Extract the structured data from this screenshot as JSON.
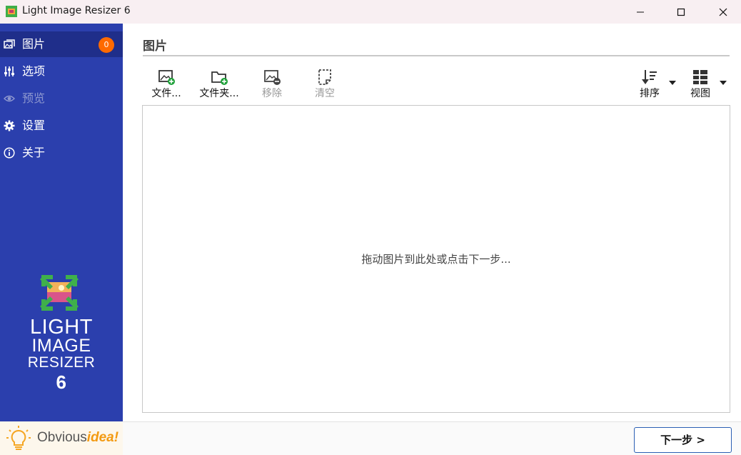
{
  "window": {
    "title": "Light Image Resizer 6"
  },
  "sidebar": {
    "items": [
      {
        "label": "图片",
        "badge": "0",
        "icon": "images-icon",
        "active": true
      },
      {
        "label": "选项",
        "icon": "sliders-icon"
      },
      {
        "label": "预览",
        "icon": "eye-icon",
        "disabled": true
      },
      {
        "label": "设置",
        "icon": "gear-icon"
      },
      {
        "label": "关于",
        "icon": "info-icon"
      }
    ],
    "brand": {
      "line1": "LIGHT",
      "line2": "IMAGE",
      "line3": "RESIZER",
      "line4": "6"
    },
    "vendor": {
      "part1": "Obvious",
      "part2": "idea!"
    }
  },
  "main": {
    "title": "图片",
    "toolbar": {
      "files_label": "文件...",
      "folder_label": "文件夹...",
      "remove_label": "移除",
      "clear_label": "清空",
      "sort_label": "排序",
      "view_label": "视图"
    },
    "drop_hint": "拖动图片到此处或点击下一步...",
    "next_button": "下一步 >"
  },
  "colors": {
    "sidebar_bg": "#2b3fad",
    "sidebar_active": "#1f2e8a",
    "badge": "#ff6a00",
    "titlebar": "#f8eff2",
    "add_green": "#1fa13a"
  }
}
